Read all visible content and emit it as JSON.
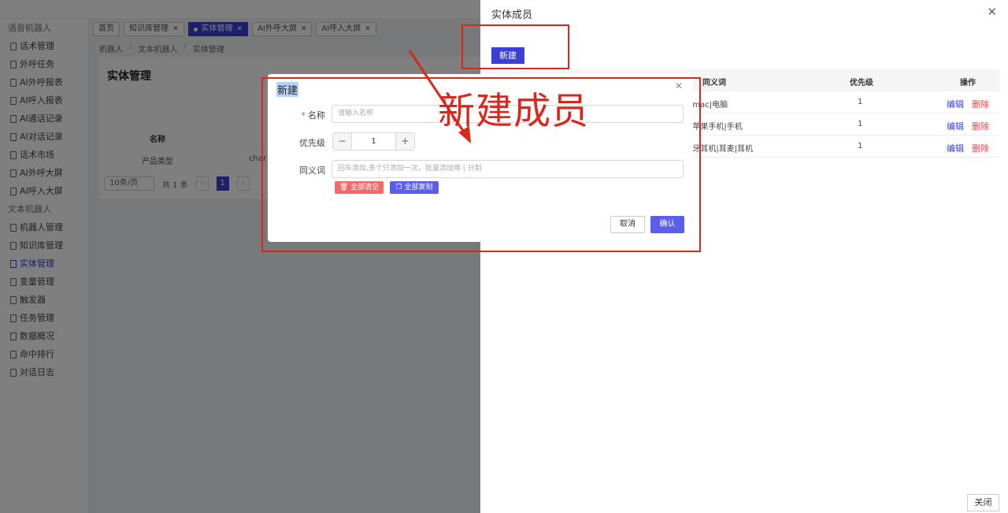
{
  "sidebar": {
    "voice_group": "语音机器人",
    "voice_items": [
      {
        "label": "话术管理"
      },
      {
        "label": "外呼任务"
      },
      {
        "label": "AI外呼报表"
      },
      {
        "label": "AI呼入报表"
      },
      {
        "label": "AI通话记录"
      },
      {
        "label": "AI对话记录"
      },
      {
        "label": "话术市场"
      },
      {
        "label": "AI外呼大屏"
      },
      {
        "label": "AI呼入大屏"
      }
    ],
    "text_group": "文本机器人",
    "text_items": [
      {
        "label": "机器人管理"
      },
      {
        "label": "知识库管理"
      },
      {
        "label": "实体管理",
        "active": true
      },
      {
        "label": "变量管理"
      },
      {
        "label": "触发器"
      },
      {
        "label": "任务管理"
      },
      {
        "label": "数据概况"
      },
      {
        "label": "命中排行"
      },
      {
        "label": "对话日志"
      }
    ]
  },
  "tabs": [
    {
      "label": "首页"
    },
    {
      "label": "知识库管理"
    },
    {
      "label": "实体管理",
      "active": true
    },
    {
      "label": "AI外呼大屏"
    },
    {
      "label": "AI呼入大屏"
    }
  ],
  "breadcrumb": [
    "机器人",
    "文本机器人",
    "实体管理"
  ],
  "page": {
    "title": "实体管理",
    "col_name": "名称",
    "row_name": "产品类型",
    "row_partial": "char",
    "pager": {
      "page_size": "10条/页",
      "total": "共 1 条",
      "current": "1"
    }
  },
  "drawer": {
    "title": "实体成员",
    "new_button": "新建",
    "columns": {
      "synonyms": "同义词",
      "priority": "优先级",
      "ops": "操作"
    },
    "rows": [
      {
        "synonyms": "记本|mac|电脑",
        "priority": "1",
        "edit": "编辑",
        "delete": "删除"
      },
      {
        "synonyms": "手机|苹果手机|手机",
        "priority": "1",
        "edit": "编辑",
        "delete": "删除"
      },
      {
        "synonyms": "机|蓝牙耳机|耳麦|耳机",
        "priority": "1",
        "edit": "编辑",
        "delete": "删除"
      }
    ],
    "close_button": "关闭"
  },
  "modal": {
    "title": "新建",
    "name_label": "名称",
    "name_placeholder": "请输入名称",
    "priority_label": "优先级",
    "priority_value": "1",
    "synonyms_label": "同义词",
    "synonyms_placeholder": "回车添加,多个只添加一次，批量添加用 | 分割",
    "clear_all": "全部清空",
    "copy_all": "全部复制",
    "cancel": "取消",
    "confirm": "确认"
  },
  "annotation": {
    "text": "新建成员",
    "color": "#d8281e"
  },
  "colors": {
    "primary": "#3b3fd6",
    "danger": "#e04646"
  }
}
